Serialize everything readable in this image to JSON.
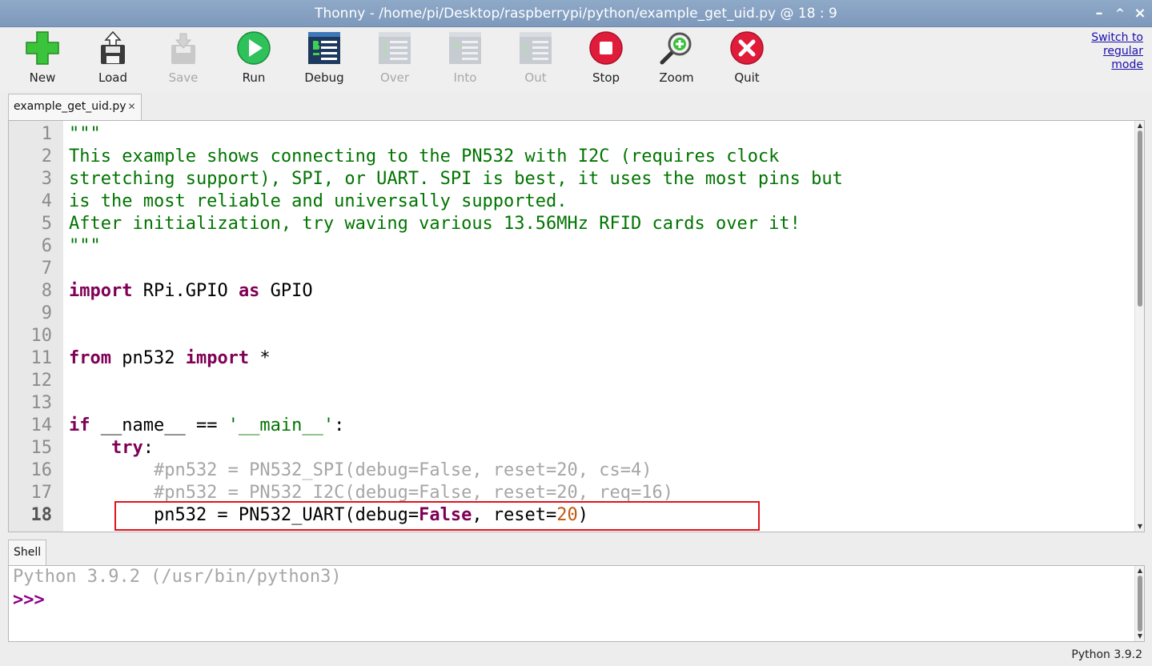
{
  "window": {
    "title": "Thonny  -  /home/pi/Desktop/raspberrypi/python/example_get_uid.py  @  18 : 9",
    "controls": {
      "minimize": "–",
      "maximize": "^",
      "close": "×"
    }
  },
  "toolbar": {
    "new": "New",
    "load": "Load",
    "save": "Save",
    "run": "Run",
    "debug": "Debug",
    "over": "Over",
    "into": "Into",
    "out": "Out",
    "stop": "Stop",
    "zoom": "Zoom",
    "quit": "Quit",
    "switch_mode": "Switch to regular mode"
  },
  "editor": {
    "tab_label": "example_get_uid.py",
    "tab_close": "✕",
    "line_numbers": [
      "1",
      "2",
      "3",
      "4",
      "5",
      "6",
      "7",
      "8",
      "9",
      "10",
      "11",
      "12",
      "13",
      "14",
      "15",
      "16",
      "17",
      "18"
    ],
    "current_line": "18",
    "lines": {
      "l1": "\"\"\"",
      "l2": "This example shows connecting to the PN532 with I2C (requires clock",
      "l3": "stretching support), SPI, or UART. SPI is best, it uses the most pins but",
      "l4": "is the most reliable and universally supported.",
      "l5": "After initialization, try waving various 13.56MHz RFID cards over it!",
      "l6": "\"\"\"",
      "l8_kw1": "import",
      "l8_mid": " RPi.GPIO ",
      "l8_kw2": "as",
      "l8_end": " GPIO",
      "l11_kw1": "from",
      "l11_mid": " pn532 ",
      "l11_kw2": "import",
      "l11_end": " *",
      "l14_kw": "if",
      "l14_mid": " __name__ == ",
      "l14_str": "'__main__'",
      "l14_end": ":",
      "l15_indent": "    ",
      "l15_kw": "try",
      "l15_end": ":",
      "l16": "        #pn532 = PN532_SPI(debug=False, reset=20, cs=4)",
      "l17": "        #pn532 = PN532_I2C(debug=False, reset=20, req=16)",
      "l18_a": "        pn532 = PN532_UART(debug=",
      "l18_kw": "False",
      "l18_b": ", reset=",
      "l18_num": "20",
      "l18_c": ")"
    }
  },
  "shell": {
    "tab_label": "Shell",
    "banner": "Python 3.9.2 (/usr/bin/python3)",
    "prompt": ">>>"
  },
  "status": {
    "interpreter": "Python 3.9.2"
  }
}
